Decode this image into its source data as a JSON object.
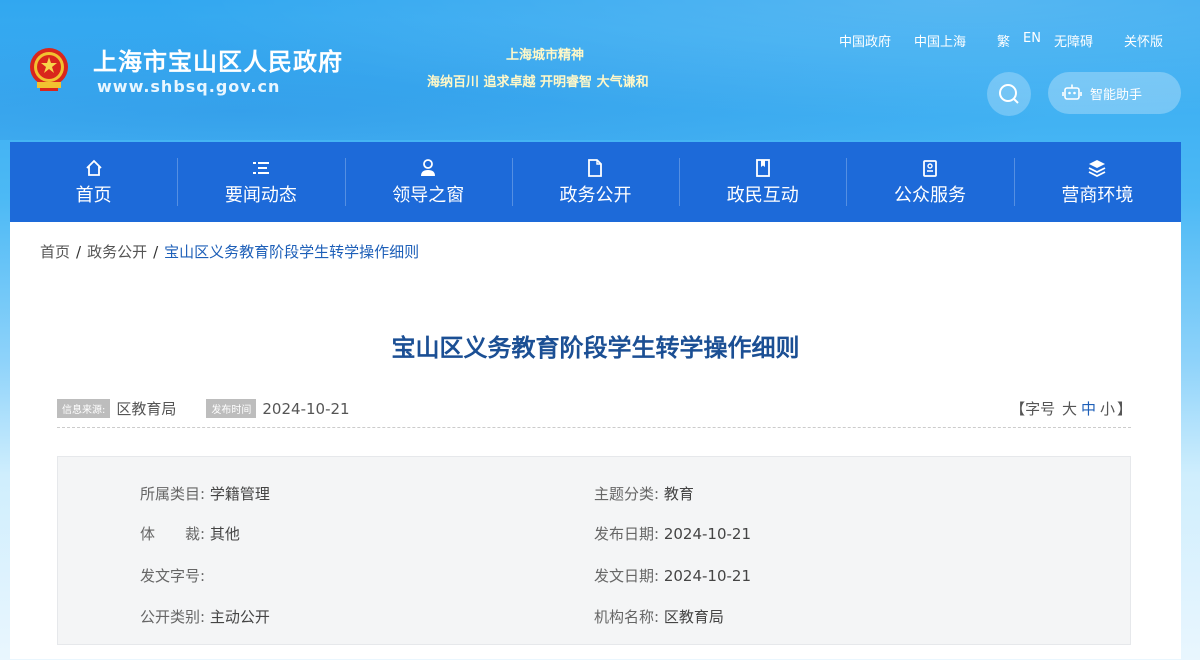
{
  "header": {
    "site_name": "上海市宝山区人民政府",
    "site_url": "www.shbsq.gov.cn",
    "spirit_title": "上海城市精神",
    "spirit_text": "海纳百川 追求卓越 开明睿智 大气谦和",
    "top_links": [
      "中国政府",
      "中国上海",
      "繁",
      "EN",
      "无障碍",
      "关怀版"
    ],
    "assistant_label": "智能助手"
  },
  "nav": {
    "items": [
      {
        "label": "首页",
        "icon": "home-icon"
      },
      {
        "label": "要闻动态",
        "icon": "list-icon"
      },
      {
        "label": "领导之窗",
        "icon": "person-icon"
      },
      {
        "label": "政务公开",
        "icon": "document-icon"
      },
      {
        "label": "政民互动",
        "icon": "bookmark-icon"
      },
      {
        "label": "公众服务",
        "icon": "clipboard-icon"
      },
      {
        "label": "营商环境",
        "icon": "layers-icon"
      }
    ]
  },
  "breadcrumb": {
    "items": [
      "首页",
      "政务公开",
      "宝山区义务教育阶段学生转学操作细则"
    ],
    "separator": "/"
  },
  "article": {
    "title": "宝山区义务教育阶段学生转学操作细则",
    "source_tag": "信息来源:",
    "source": "区教育局",
    "date_tag": "发布时间",
    "date": "2024-10-21",
    "font_size_open": "【字号",
    "font_sizes": [
      "大",
      "中",
      "小"
    ],
    "font_size_close": "】"
  },
  "info": {
    "category_label": "所属类目:",
    "category": "学籍管理",
    "topic_label": "主题分类:",
    "topic": "教育",
    "genre_label": "体　　裁:",
    "genre": "其他",
    "publish_date_label": "发布日期:",
    "publish_date": "2024-10-21",
    "doc_no_label": "发文字号:",
    "doc_no": "",
    "issue_date_label": "发文日期:",
    "issue_date": "2024-10-21",
    "open_type_label": "公开类别:",
    "open_type": "主动公开",
    "org_label": "机构名称:",
    "org": "区教育局"
  },
  "colors": {
    "nav_bg": "#1d6ad9",
    "title": "#1b4f94",
    "accent": "#1d5fb8"
  }
}
